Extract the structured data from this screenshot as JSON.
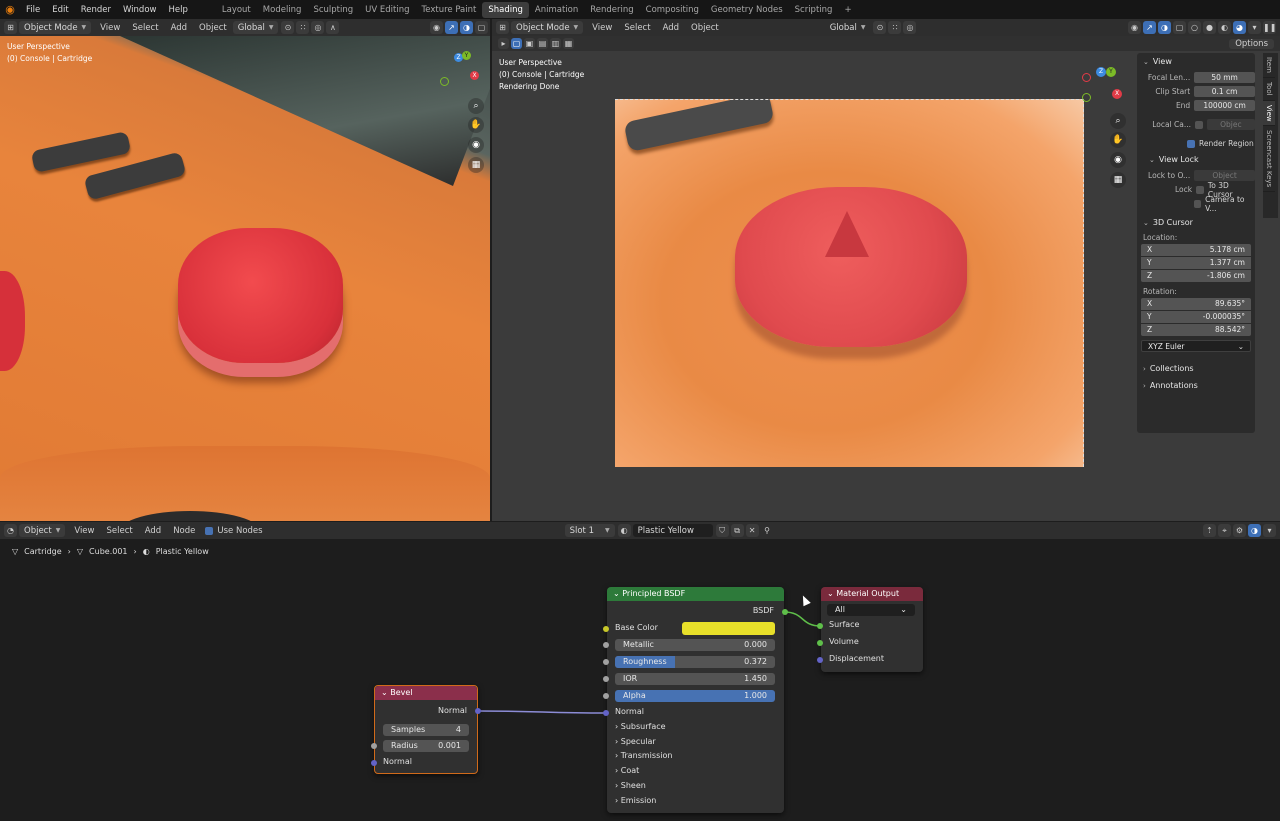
{
  "topbar": {
    "menu": [
      "File",
      "Edit",
      "Render",
      "Window",
      "Help"
    ],
    "workspaces": [
      "Layout",
      "Modeling",
      "Sculpting",
      "UV Editing",
      "Texture Paint",
      "Shading",
      "Animation",
      "Rendering",
      "Compositing",
      "Geometry Nodes",
      "Scripting"
    ],
    "active_workspace": "Shading",
    "add_label": "+"
  },
  "left_viewport": {
    "mode": "Object Mode",
    "menus": [
      "View",
      "Select",
      "Add",
      "Object"
    ],
    "transform": "Global",
    "overlay_line1": "User Perspective",
    "overlay_line2": "(0) Console | Cartridge",
    "gizmo": {
      "x": "X",
      "y": "Y",
      "z": "Z"
    }
  },
  "right_viewport": {
    "mode": "Object Mode",
    "menus": [
      "View",
      "Select",
      "Add",
      "Object"
    ],
    "transform": "Global",
    "options_label": "Options",
    "overlay_line1": "User Perspective",
    "overlay_line2": "(0) Console | Cartridge",
    "overlay_line3": "Rendering Done",
    "gizmo": {
      "x": "X",
      "y": "Y",
      "z": "Z"
    }
  },
  "npanel": {
    "view_title": "View",
    "focal_label": "Focal Len...",
    "focal_value": "50 mm",
    "clip_start_label": "Clip Start",
    "clip_start_value": "0.1 cm",
    "end_label": "End",
    "end_value": "100000 cm",
    "local_cam_label": "Local Ca...",
    "local_cam_placeholder": "Objec",
    "render_region_label": "Render Region",
    "view_lock_title": "View Lock",
    "lock_to_label": "Lock to O...",
    "lock_to_placeholder": "Object",
    "lock_label": "Lock",
    "to_3d_cursor_label": "To 3D Cursor",
    "camera_to_view_label": "Camera to V...",
    "cursor_title": "3D Cursor",
    "location_label": "Location:",
    "loc_x": "5.178 cm",
    "loc_y": "1.377 cm",
    "loc_z": "-1.806 cm",
    "rotation_label": "Rotation:",
    "rot_x": "89.635°",
    "rot_y": "-0.000035°",
    "rot_z": "88.542°",
    "rotation_mode": "XYZ Euler",
    "collections_label": "Collections",
    "annotations_label": "Annotations",
    "axis_x": "X",
    "axis_y": "Y",
    "axis_z": "Z",
    "tabs": [
      "Item",
      "Tool",
      "View",
      "Screencast Keys"
    ]
  },
  "node_editor": {
    "type": "Object",
    "menus": [
      "View",
      "Select",
      "Add",
      "Node"
    ],
    "use_nodes_label": "Use Nodes",
    "slot": "Slot 1",
    "material": "Plastic Yellow",
    "breadcrumb": [
      "Cartridge",
      "Cube.001",
      "Plastic Yellow"
    ]
  },
  "bevel_node": {
    "title": "Bevel",
    "output": "Normal",
    "samples_label": "Samples",
    "samples_value": "4",
    "radius_label": "Radius",
    "radius_value": "0.001",
    "input": "Normal"
  },
  "bsdf_node": {
    "title": "Principled BSDF",
    "output": "BSDF",
    "base_color_label": "Base Color",
    "base_color_hex": "#e8e02a",
    "metallic_label": "Metallic",
    "metallic_value": "0.000",
    "roughness_label": "Roughness",
    "roughness_value": "0.372",
    "roughness_fraction": 0.372,
    "ior_label": "IOR",
    "ior_value": "1.450",
    "alpha_label": "Alpha",
    "alpha_value": "1.000",
    "normal_label": "Normal",
    "panels": [
      "Subsurface",
      "Specular",
      "Transmission",
      "Coat",
      "Sheen",
      "Emission"
    ]
  },
  "output_node": {
    "title": "Material Output",
    "target": "All",
    "inputs": [
      "Surface",
      "Volume",
      "Displacement"
    ]
  }
}
